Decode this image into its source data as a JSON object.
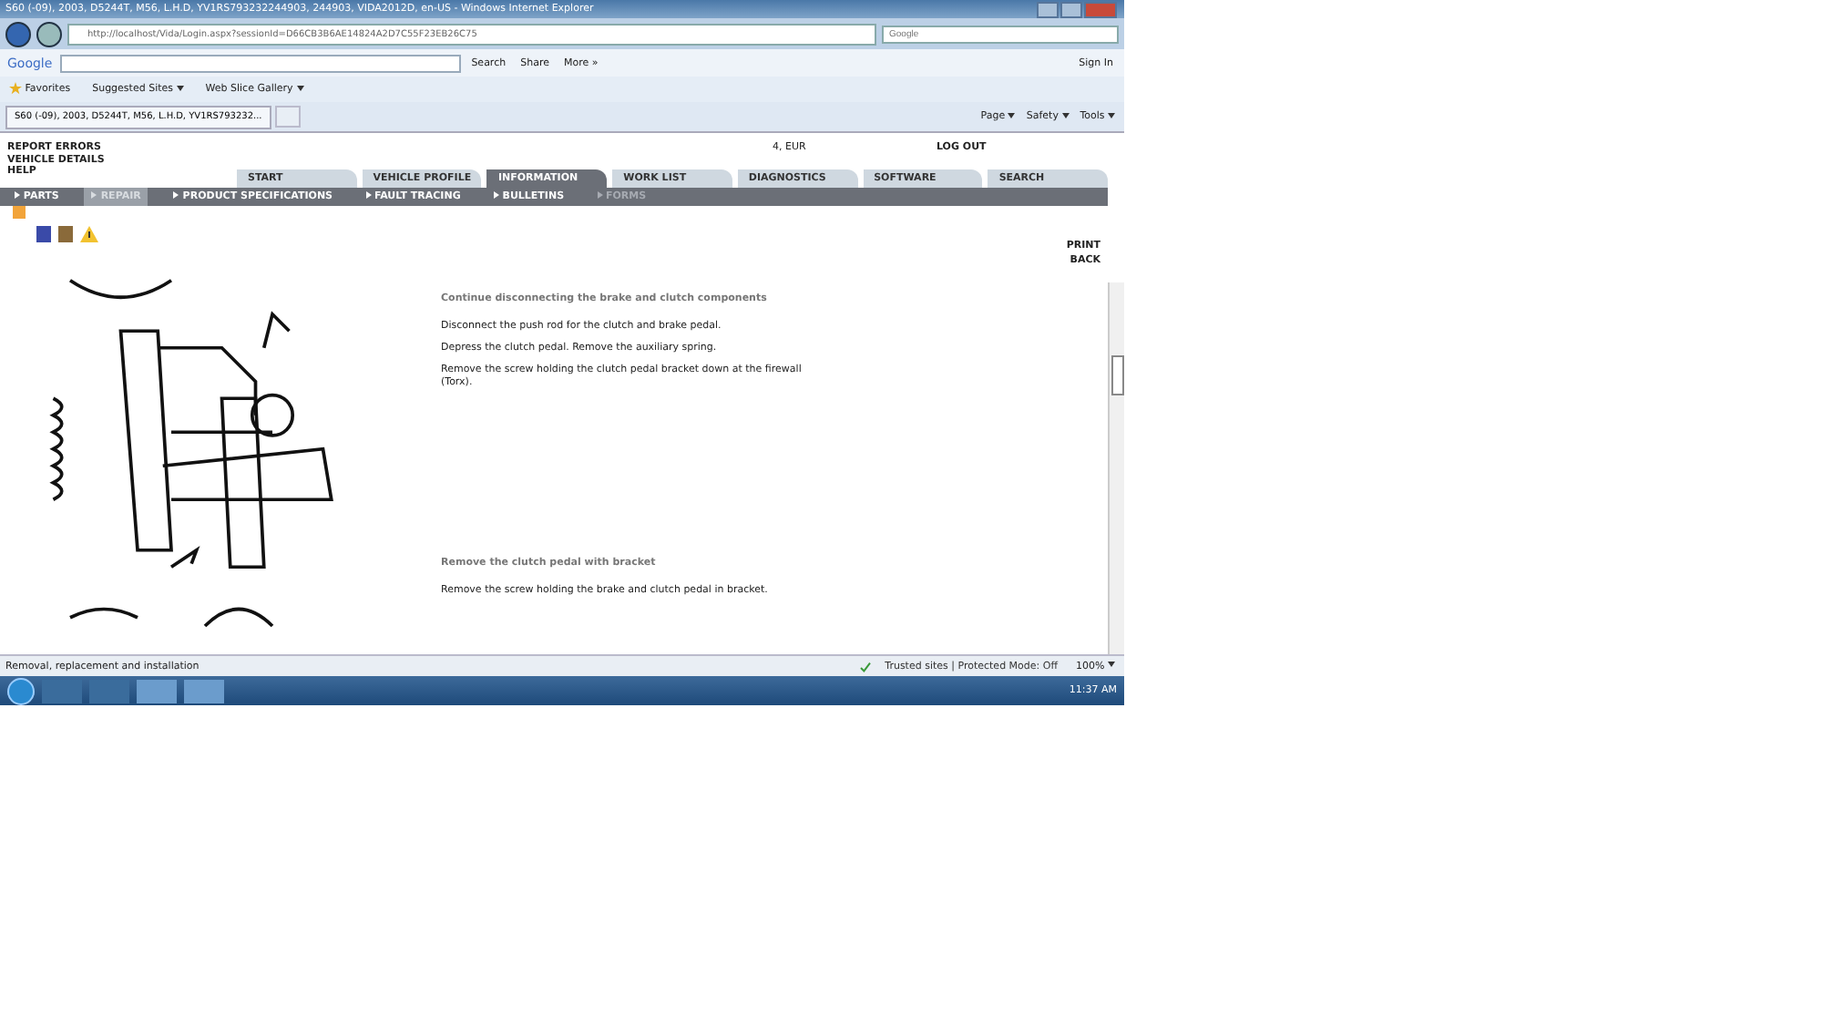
{
  "window": {
    "title": "S60 (-09), 2003, D5244T, M56, L.H.D, YV1RS793232244903, 244903, VIDA2012D, en-US - Windows Internet Explorer"
  },
  "address_bar": {
    "url": "http://localhost/Vida/Login.aspx?sessionId=D66CB3B6AE14824A2D7C55F23EB26C75",
    "search_placeholder": "Google"
  },
  "google_toolbar": {
    "logo": "Google",
    "search": "Search",
    "share": "Share",
    "more": "More »",
    "sign_in": "Sign In"
  },
  "favorites_bar": {
    "favorites": "Favorites",
    "links": [
      "Suggested Sites",
      "Web Slice Gallery"
    ]
  },
  "browser_tab": {
    "title": "S60 (-09), 2003, D5244T, M56, L.H.D, YV1RS793232..."
  },
  "command_bar": [
    "Page",
    "Safety",
    "Tools"
  ],
  "top_links": [
    "REPORT ERRORS",
    "VEHICLE DETAILS",
    "HELP"
  ],
  "account": "4, EUR",
  "logout": "LOG OUT",
  "main_tabs": [
    {
      "label": "START",
      "selected": false
    },
    {
      "label": "VEHICLE PROFILE",
      "selected": false
    },
    {
      "label": "INFORMATION",
      "selected": true
    },
    {
      "label": "WORK LIST",
      "selected": false
    },
    {
      "label": "DIAGNOSTICS",
      "selected": false
    },
    {
      "label": "SOFTWARE",
      "selected": false
    },
    {
      "label": "SEARCH",
      "selected": false
    }
  ],
  "sub_tabs": [
    {
      "label": "PARTS",
      "selected": false,
      "disabled": false
    },
    {
      "label": "REPAIR",
      "selected": true,
      "disabled": false
    },
    {
      "label": "PRODUCT SPECIFICATIONS",
      "selected": false,
      "disabled": false
    },
    {
      "label": "FAULT TRACING",
      "selected": false,
      "disabled": false
    },
    {
      "label": "BULLETINS",
      "selected": false,
      "disabled": false
    },
    {
      "label": "FORMS",
      "selected": false,
      "disabled": true
    }
  ],
  "nav_links": [
    "PRINT",
    "BACK"
  ],
  "sections": [
    {
      "heading": "Continue disconnecting the brake and clutch components",
      "paragraphs": [
        "Disconnect the push rod for the clutch and brake pedal.",
        "Depress the clutch pedal. Remove the auxiliary spring.",
        "Remove the screw holding the clutch pedal bracket down at the firewall (Torx)."
      ]
    },
    {
      "heading": "Remove the clutch pedal with bracket",
      "paragraphs": [
        "Remove the screw holding the brake and clutch pedal in bracket."
      ]
    }
  ],
  "status_bar": {
    "text": "Removal, replacement and installation",
    "zone": "Trusted sites | Protected Mode: Off",
    "zoom": "100%"
  },
  "taskbar": {
    "clock": "11:37 AM"
  }
}
